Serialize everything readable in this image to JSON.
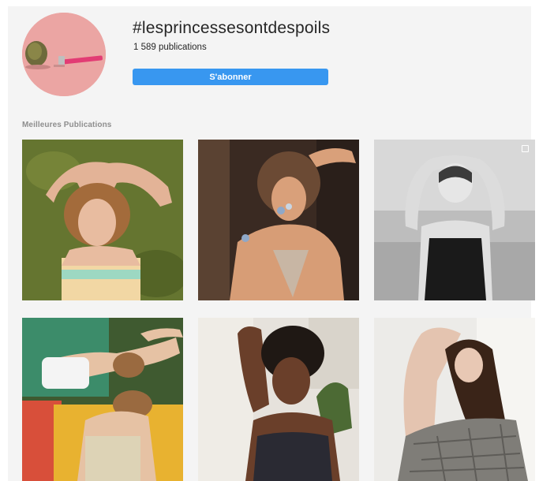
{
  "header": {
    "hashtag": "#lesprincessesontdespoils",
    "post_count": "1 589 publications",
    "follow_label": "S'abonner"
  },
  "section": {
    "title": "Meilleures Publications"
  },
  "colors": {
    "accent": "#3897f0",
    "background": "#f4f4f4",
    "text": "#262626",
    "muted": "#8e8e8e"
  },
  "posts_count": 6,
  "icons": [
    "multiple-photos-icon"
  ]
}
